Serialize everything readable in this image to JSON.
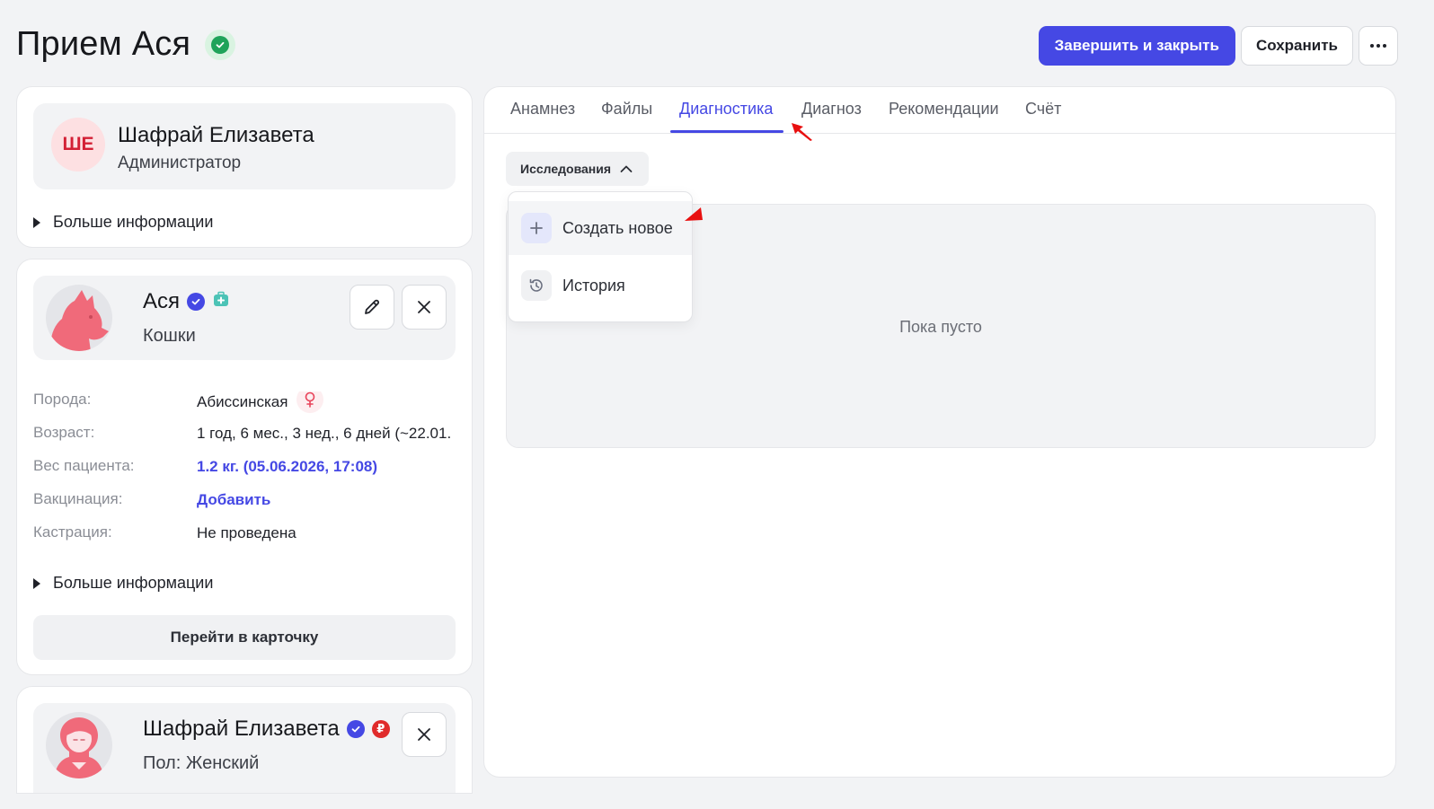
{
  "header": {
    "title": "Прием Ася",
    "finish_label": "Завершить и закрыть",
    "save_label": "Сохранить"
  },
  "user_card": {
    "initials": "ШЕ",
    "name": "Шафрай Елизавета",
    "role": "Администратор",
    "more_info": "Больше информации"
  },
  "pet_card": {
    "name": "Ася",
    "species": "Кошки",
    "details": [
      {
        "label": "Порода:",
        "value": "Абиссинская"
      },
      {
        "label": "Возраст:",
        "value": "1 год, 6 мес., 3 нед., 6 дней (~22.01."
      },
      {
        "label": "Вес пациента:",
        "value": "1.2 кг. (05.06.2026, 17:08)"
      },
      {
        "label": "Вакцинация:",
        "value": "Добавить"
      },
      {
        "label": "Кастрация:",
        "value": "Не проведена"
      }
    ],
    "more_info": "Больше информации",
    "goto_label": "Перейти в карточку"
  },
  "owner_card": {
    "name": "Шафрай Елизавета",
    "sex": "Пол: Женский",
    "currency_symbol": "₽"
  },
  "tabs": [
    {
      "label": "Анамнез"
    },
    {
      "label": "Файлы"
    },
    {
      "label": "Диагностика"
    },
    {
      "label": "Диагноз"
    },
    {
      "label": "Рекомендации"
    },
    {
      "label": "Счёт"
    }
  ],
  "diagnostics": {
    "dropdown_label": "Исследования",
    "menu": [
      {
        "label": "Создать новое",
        "icon": "plus-icon"
      },
      {
        "label": "История",
        "icon": "history-icon"
      }
    ],
    "empty_text": "Пока пусто"
  },
  "colors": {
    "accent": "#4548e4",
    "success": "#1fa35a",
    "danger": "#e02b2b",
    "background": "#f2f3f5"
  }
}
